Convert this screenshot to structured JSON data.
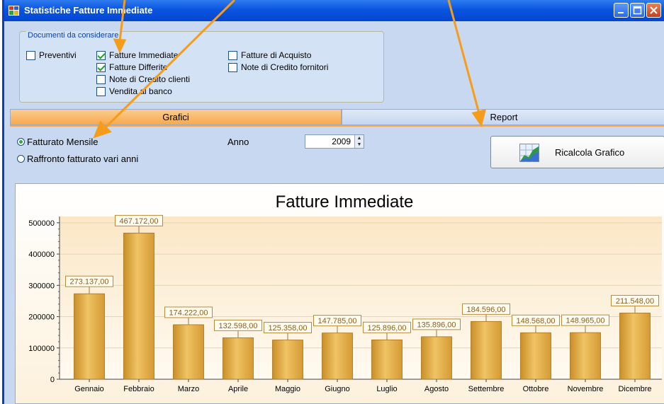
{
  "window": {
    "title": "Statistiche Fatture Immediate"
  },
  "documents": {
    "legend": "Documenti da considerare",
    "options": [
      {
        "label": "Preventivi",
        "checked": false
      },
      {
        "label": "Fatture Immediate",
        "checked": true
      },
      {
        "label": "Fatture Differite",
        "checked": true
      },
      {
        "label": "Note di Credito clienti",
        "checked": false
      },
      {
        "label": "Vendita al banco",
        "checked": false
      },
      {
        "label": "Fatture di Acquisto",
        "checked": false
      },
      {
        "label": "Note di Credito fornitori",
        "checked": false
      }
    ]
  },
  "tabs": {
    "grafici": "Grafici",
    "report": "Report",
    "active": "Grafici"
  },
  "options": {
    "radio_monthly": "Fatturato Mensile",
    "radio_compare": "Raffronto fatturato vari anni",
    "selected": "Fatturato Mensile",
    "anno_label": "Anno",
    "anno_value": "2009",
    "recalc_label": "Ricalcola Grafico"
  },
  "chart_data": {
    "type": "bar",
    "title": "Fatture Immediate",
    "categories": [
      "Gennaio",
      "Febbraio",
      "Marzo",
      "Aprile",
      "Maggio",
      "Giugno",
      "Luglio",
      "Agosto",
      "Settembre",
      "Ottobre",
      "Novembre",
      "Dicembre"
    ],
    "values": [
      273137,
      467172,
      174222,
      132598,
      125358,
      147785,
      125896,
      135896,
      184596,
      148568,
      148965,
      211548
    ],
    "data_labels": [
      "273.137,00",
      "467.172,00",
      "174.222,00",
      "132.598,00",
      "125.358,00",
      "147.785,00",
      "125.896,00",
      "135.896,00",
      "184.596,00",
      "148.568,00",
      "148.965,00",
      "211.548,00"
    ],
    "yticks": [
      0,
      100000,
      200000,
      300000,
      400000,
      500000
    ],
    "ytick_labels": [
      "0",
      "100000",
      "200000",
      "300000",
      "400000",
      "500000"
    ],
    "ylim": [
      0,
      520000
    ],
    "grid": true,
    "bar_color": "#d9a43c",
    "bar_highlight": "#f2c766"
  },
  "colors": {
    "titlebar": "#0a55e0",
    "active_tab": "#f7a84d",
    "annotation_arrow": "#f59c1a"
  }
}
